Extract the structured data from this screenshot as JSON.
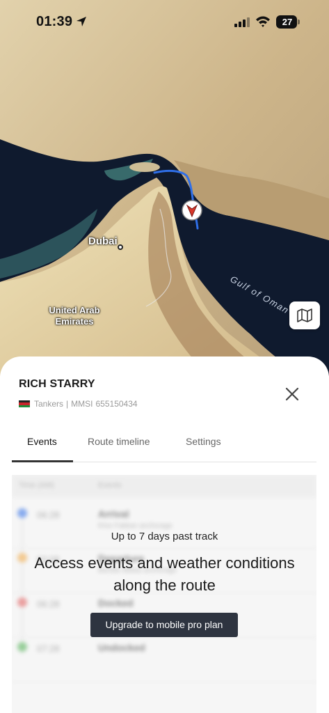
{
  "status_bar": {
    "time": "01:39",
    "battery_level": "27",
    "icons": [
      "location-arrow-icon",
      "cellular-signal-icon",
      "wifi-icon",
      "battery-icon"
    ]
  },
  "map": {
    "labels": {
      "dubai": "Dubai",
      "uae": "United Arab\nEmirates",
      "gulf": "Gulf of Oman"
    },
    "layer_button_icon": "map-icon",
    "route_color": "#2f6fe8",
    "marker_color": "#d9382b"
  },
  "vessel": {
    "name": "RICH STARRY",
    "type": "Tankers",
    "mmsi_label": "MMSI",
    "mmsi": "655150434",
    "flag_icon": "kenya-flag-icon"
  },
  "tabs": [
    {
      "label": "Events",
      "active": true
    },
    {
      "label": "Route timeline",
      "active": false
    },
    {
      "label": "Settings",
      "active": false
    }
  ],
  "paywall": {
    "subtitle": "Up to 7 days past track",
    "headline": "Access events and weather conditions along the route",
    "cta": "Upgrade to mobile pro plan"
  },
  "blurred_events": {
    "headers": [
      "Time (AM)",
      "Events"
    ],
    "rows": [
      {
        "time": "06:28",
        "title": "Arrival",
        "sub": "Khor Fakkan anchorage",
        "color": "#2f6fe8"
      },
      {
        "time": "02:08",
        "title": "Departure",
        "sub": "Bandar Abbas anchorage",
        "color": "#f0a640"
      },
      {
        "time": "06:28",
        "title": "Docked",
        "sub": "",
        "color": "#e05a5a"
      },
      {
        "time": "07:28",
        "title": "Undocked",
        "sub": "",
        "color": "#4caf50"
      }
    ]
  }
}
